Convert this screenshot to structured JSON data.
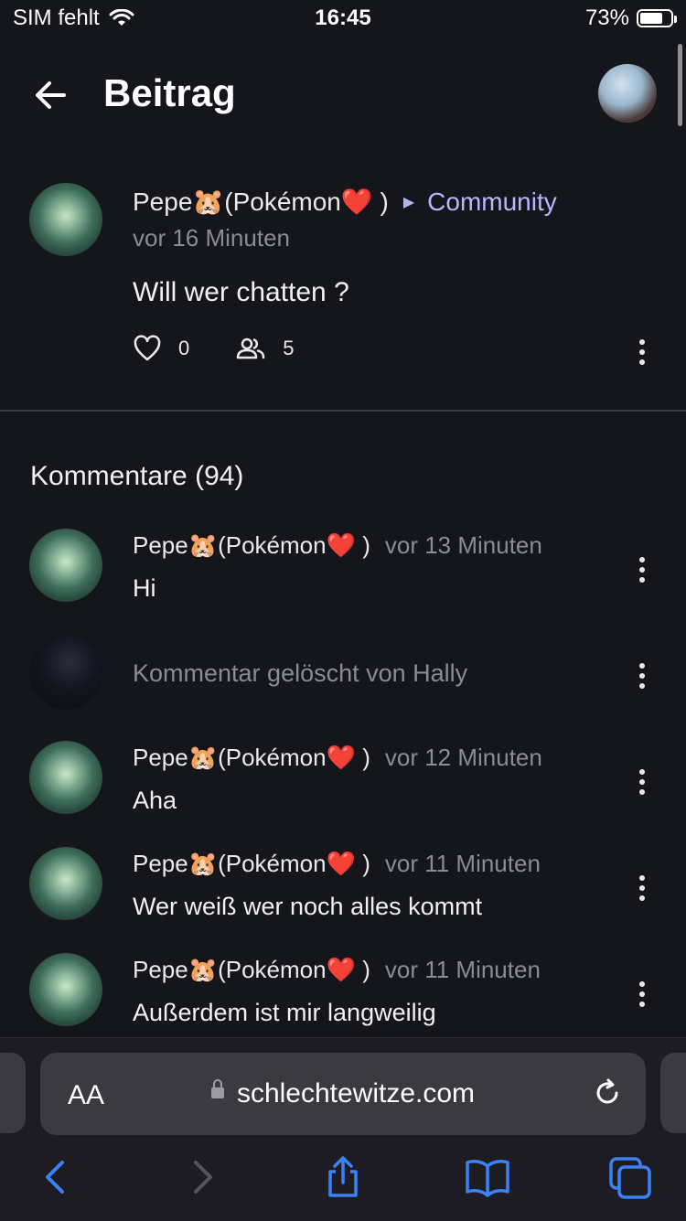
{
  "status_bar": {
    "carrier": "SIM fehlt",
    "time": "16:45",
    "battery": "73%",
    "battery_level": 0.73
  },
  "header": {
    "title": "Beitrag"
  },
  "post": {
    "author": "Pepe🐹(Pokémon❤️ )",
    "community": "Community",
    "time": "vor 16 Minuten",
    "text": "Will wer chatten ?",
    "likes": "0",
    "participants": "5"
  },
  "comments_title": "Kommentare (94)",
  "comments": [
    {
      "author": "Pepe🐹(Pokémon❤️ )",
      "time": "vor 13 Minuten",
      "text": "Hi"
    },
    {
      "deleted_text": "Kommentar gelöscht von Hally"
    },
    {
      "author": "Pepe🐹(Pokémon❤️ )",
      "time": "vor 12 Minuten",
      "text": "Aha"
    },
    {
      "author": "Pepe🐹(Pokémon❤️ )",
      "time": "vor 11 Minuten",
      "text": "Wer weiß wer noch alles kommt"
    },
    {
      "author": "Pepe🐹(Pokémon❤️ )",
      "time": "vor 11 Minuten",
      "text": "Außerdem ist mir langweilig"
    }
  ],
  "browser": {
    "text_size_label": "AA",
    "url": "schlechtewitze.com"
  },
  "colors": {
    "background": "#15151c",
    "accent": "#b8b6ff",
    "toolbar_blue": "#3b82f6"
  }
}
